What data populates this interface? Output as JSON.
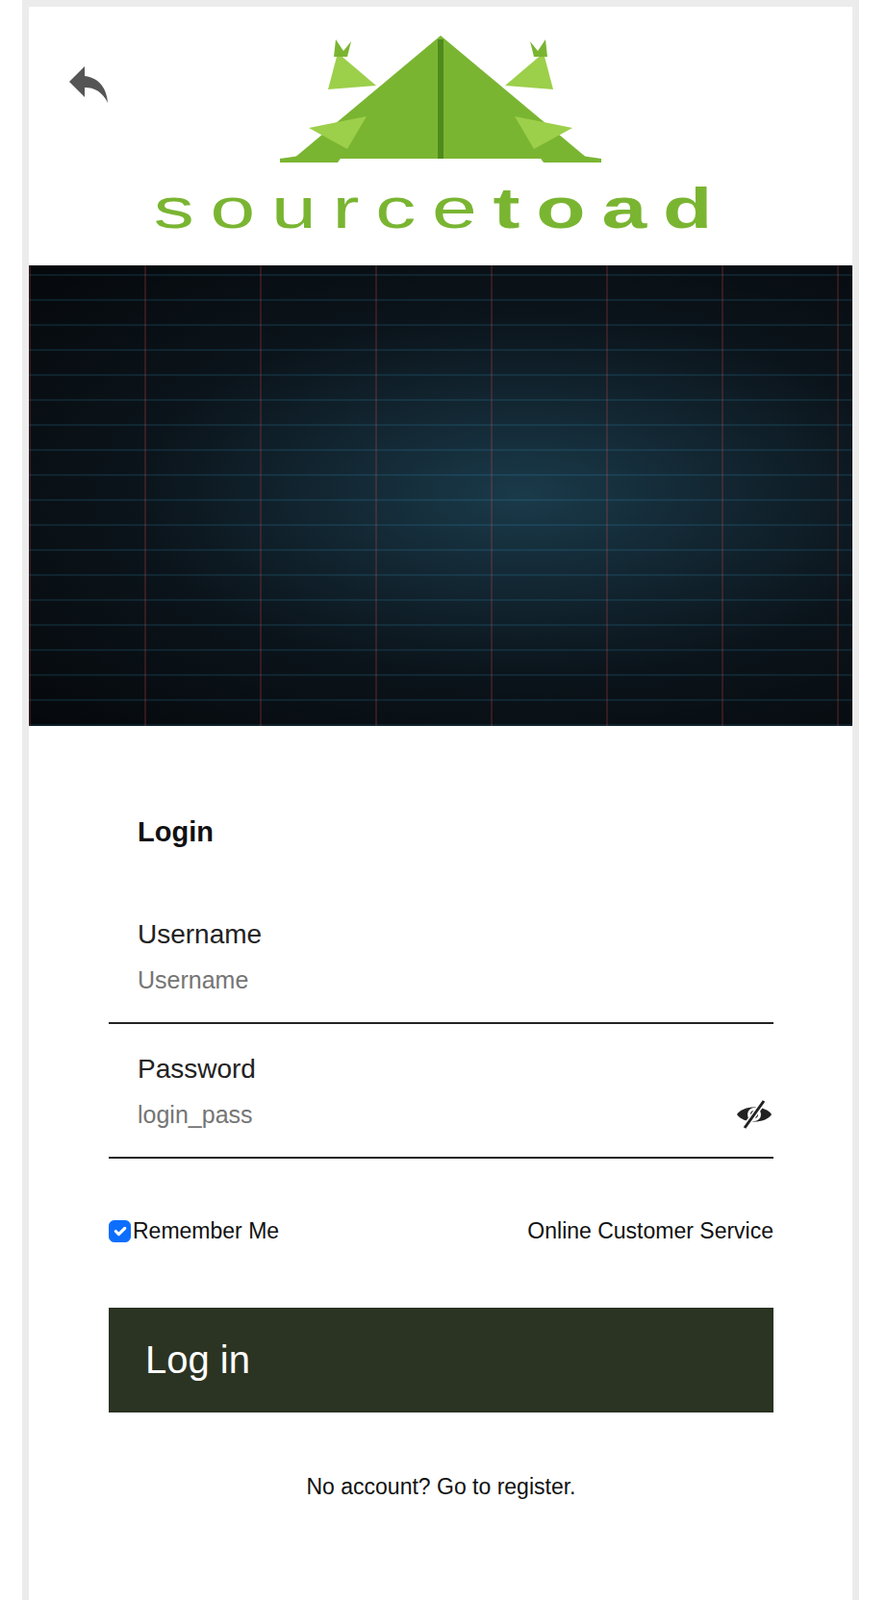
{
  "logo": {
    "light": "source",
    "bold": "toad"
  },
  "form": {
    "title": "Login",
    "fields": [
      {
        "label": "Username",
        "placeholder": "Username",
        "kind": "text"
      },
      {
        "label": "Password",
        "placeholder": "login_pass",
        "kind": "password"
      }
    ],
    "remember": {
      "label": "Remember Me",
      "checked": true
    },
    "service_link": "Online Customer Service",
    "submit": "Log in",
    "register_link": "No account? Go to register."
  }
}
